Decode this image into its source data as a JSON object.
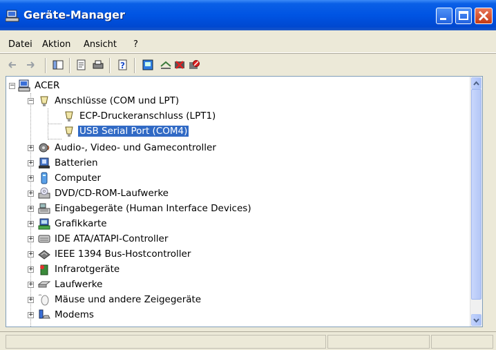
{
  "window": {
    "title": "Geräte-Manager"
  },
  "menu": [
    "Datei",
    "Aktion",
    "Ansicht",
    "?"
  ],
  "toolbar": {
    "icons": [
      "back-arrow-icon",
      "forward-arrow-icon",
      "console-tree-icon",
      "properties-icon",
      "print-icon",
      "help-icon",
      "scan-hardware-icon",
      "update-driver-icon",
      "uninstall-icon",
      "disable-icon"
    ]
  },
  "tree": {
    "root": "ACER",
    "items": [
      {
        "label": "Anschlüsse (COM und LPT)",
        "expanded": true,
        "icon": "port-icon",
        "children": [
          {
            "label": "ECP-Druckeranschluss (LPT1)",
            "icon": "port-icon"
          },
          {
            "label": "USB Serial Port (COM4)",
            "icon": "port-icon",
            "selected": true
          }
        ]
      },
      {
        "label": "Audio-, Video- und Gamecontroller",
        "icon": "audio-icon"
      },
      {
        "label": "Batterien",
        "icon": "battery-icon"
      },
      {
        "label": "Computer",
        "icon": "computer-icon"
      },
      {
        "label": "DVD/CD-ROM-Laufwerke",
        "icon": "cd-drive-icon"
      },
      {
        "label": "Eingabegeräte (Human Interface Devices)",
        "icon": "hid-icon"
      },
      {
        "label": "Grafikkarte",
        "icon": "display-adapter-icon"
      },
      {
        "label": "IDE ATA/ATAPI-Controller",
        "icon": "ide-controller-icon"
      },
      {
        "label": "IEEE 1394 Bus-Hostcontroller",
        "icon": "firewire-icon"
      },
      {
        "label": "Infrarotgeräte",
        "icon": "infrared-icon"
      },
      {
        "label": "Laufwerke",
        "icon": "disk-drive-icon"
      },
      {
        "label": "Mäuse und andere Zeigegeräte",
        "icon": "mouse-icon"
      },
      {
        "label": "Modems",
        "icon": "modem-icon"
      }
    ]
  },
  "colors": {
    "selection": "#316ac5",
    "titlebar": "#0054e3"
  }
}
